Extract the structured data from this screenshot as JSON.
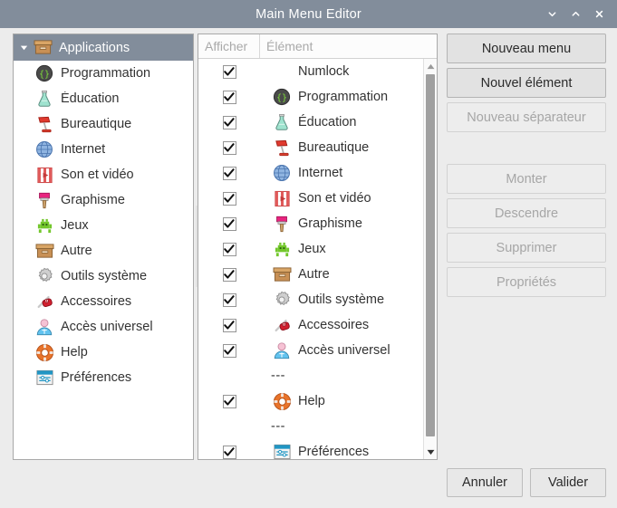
{
  "window": {
    "title": "Main Menu Editor",
    "controls": [
      {
        "name": "minimize",
        "glyph": "chevron-down"
      },
      {
        "name": "maximize",
        "glyph": "chevron-up"
      },
      {
        "name": "close",
        "glyph": "close-x"
      }
    ]
  },
  "tree": {
    "root": {
      "label": "Applications",
      "icon": "archive-box-icon",
      "expanded": true,
      "selected": true
    },
    "items": [
      {
        "label": "Programmation",
        "icon": "code-braces-icon"
      },
      {
        "label": "Éducation",
        "icon": "flask-icon"
      },
      {
        "label": "Bureautique",
        "icon": "desk-lamp-icon"
      },
      {
        "label": "Internet",
        "icon": "globe-icon"
      },
      {
        "label": "Son et vidéo",
        "icon": "film-play-icon"
      },
      {
        "label": "Graphisme",
        "icon": "paintbrush-icon"
      },
      {
        "label": "Jeux",
        "icon": "alien-invader-icon"
      },
      {
        "label": "Autre",
        "icon": "archive-box-icon"
      },
      {
        "label": "Outils système",
        "icon": "gear-icon"
      },
      {
        "label": "Accessoires",
        "icon": "swiss-knife-icon"
      },
      {
        "label": "Accès universel",
        "icon": "accessibility-person-icon"
      },
      {
        "label": "Help",
        "icon": "lifebuoy-icon"
      },
      {
        "label": "Préférences",
        "icon": "sliders-icon"
      }
    ]
  },
  "list": {
    "columns": {
      "show": "Afficher",
      "element": "Élément"
    },
    "rows": [
      {
        "type": "item",
        "checked": true,
        "label": "Numlock",
        "icon": "none"
      },
      {
        "type": "item",
        "checked": true,
        "label": "Programmation",
        "icon": "code-braces-icon"
      },
      {
        "type": "item",
        "checked": true,
        "label": "Éducation",
        "icon": "flask-icon"
      },
      {
        "type": "item",
        "checked": true,
        "label": "Bureautique",
        "icon": "desk-lamp-icon"
      },
      {
        "type": "item",
        "checked": true,
        "label": "Internet",
        "icon": "globe-icon"
      },
      {
        "type": "item",
        "checked": true,
        "label": "Son et vidéo",
        "icon": "film-play-icon"
      },
      {
        "type": "item",
        "checked": true,
        "label": "Graphisme",
        "icon": "paintbrush-icon"
      },
      {
        "type": "item",
        "checked": true,
        "label": "Jeux",
        "icon": "alien-invader-icon"
      },
      {
        "type": "item",
        "checked": true,
        "label": "Autre",
        "icon": "archive-box-icon"
      },
      {
        "type": "item",
        "checked": true,
        "label": "Outils système",
        "icon": "gear-icon"
      },
      {
        "type": "item",
        "checked": true,
        "label": "Accessoires",
        "icon": "swiss-knife-icon"
      },
      {
        "type": "item",
        "checked": true,
        "label": "Accès universel",
        "icon": "accessibility-person-icon"
      },
      {
        "type": "separator",
        "checked": false,
        "label": "---",
        "icon": "none"
      },
      {
        "type": "item",
        "checked": true,
        "label": "Help",
        "icon": "lifebuoy-icon"
      },
      {
        "type": "separator",
        "checked": false,
        "label": "---",
        "icon": "none"
      },
      {
        "type": "item",
        "checked": true,
        "label": "Préférences",
        "icon": "sliders-icon"
      }
    ]
  },
  "side_buttons": [
    {
      "label": "Nouveau menu",
      "enabled": true
    },
    {
      "label": "Nouvel élément",
      "enabled": true
    },
    {
      "label": "Nouveau séparateur",
      "enabled": false
    }
  ],
  "move_buttons": [
    {
      "label": "Monter",
      "enabled": false
    },
    {
      "label": "Descendre",
      "enabled": false
    },
    {
      "label": "Supprimer",
      "enabled": false
    },
    {
      "label": "Propriétés",
      "enabled": false
    }
  ],
  "bottom_buttons": [
    {
      "label": "Annuler"
    },
    {
      "label": "Valider"
    }
  ],
  "colors": {
    "titlebar": "#828d9b",
    "selection": "#828d9b",
    "window_bg": "#ececec",
    "panel_bg": "#ffffff",
    "text": "#333333",
    "disabled_text": "#a6a6a6"
  }
}
